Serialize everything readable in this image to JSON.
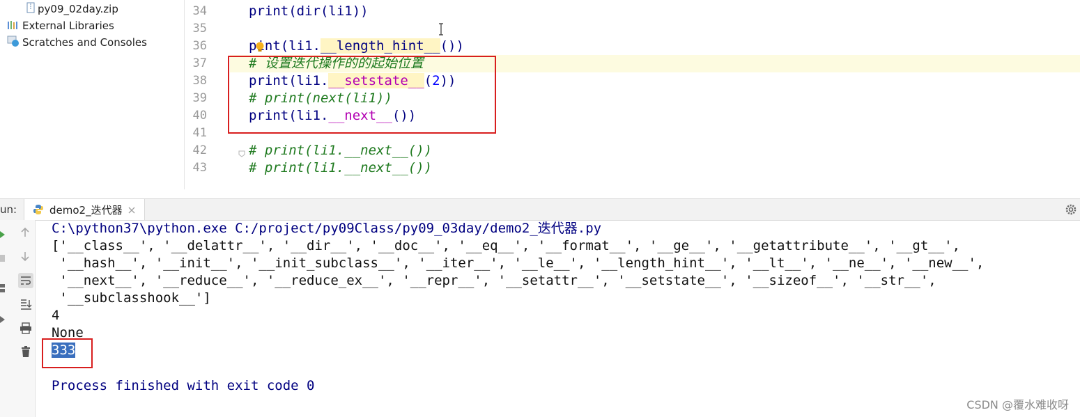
{
  "project_tree": {
    "items": [
      {
        "label": "py09_02day.zip",
        "icon": "zip-icon"
      },
      {
        "label": "External Libraries",
        "icon": "library-icon"
      },
      {
        "label": "Scratches and Consoles",
        "icon": "scratch-icon"
      }
    ]
  },
  "editor": {
    "line_numbers": [
      "34",
      "35",
      "36",
      "37",
      "38",
      "39",
      "40",
      "41",
      "42",
      "43"
    ],
    "lines": {
      "l34": "print(dir(li1))",
      "l36_a": "p",
      "l36_b": "int(li1.",
      "l36_c": "__length_hint__",
      "l36_d": "())",
      "l37": "# 设置迭代操作的的起始位置",
      "l38_a": "print(li1.",
      "l38_b": "__setstate__",
      "l38_c": "(",
      "l38_d": "2",
      "l38_e": "))",
      "l39": "# print(next(li1))",
      "l40_a": "print(li1.",
      "l40_b": "__next__",
      "l40_c": "())",
      "l42": "# print(li1.__next__())",
      "l43": "# print(li1.__next__())"
    }
  },
  "run_panel": {
    "label": "un:",
    "tab_label": "demo2_迭代器",
    "output": [
      "C:\\python37\\python.exe C:/project/py09Class/py09_03day/demo2_迭代器.py",
      "['__class__', '__delattr__', '__dir__', '__doc__', '__eq__', '__format__', '__ge__', '__getattribute__', '__gt__',",
      " '__hash__', '__init__', '__init_subclass__', '__iter__', '__le__', '__length_hint__', '__lt__', '__ne__', '__new__',",
      " '__next__', '__reduce__', '__reduce_ex__', '__repr__', '__setattr__', '__setstate__', '__sizeof__', '__str__',",
      " '__subclasshook__']",
      "4",
      "None",
      "333",
      "Process finished with exit code 0"
    ]
  },
  "watermark": "CSDN @覆水难收呀",
  "colors": {
    "keyword_blue": "#000080",
    "comment_green": "#1f7a1f",
    "magic_purple": "#b200b2",
    "annotation_red": "#d81e1e",
    "selection_blue": "#3a6fbe"
  }
}
